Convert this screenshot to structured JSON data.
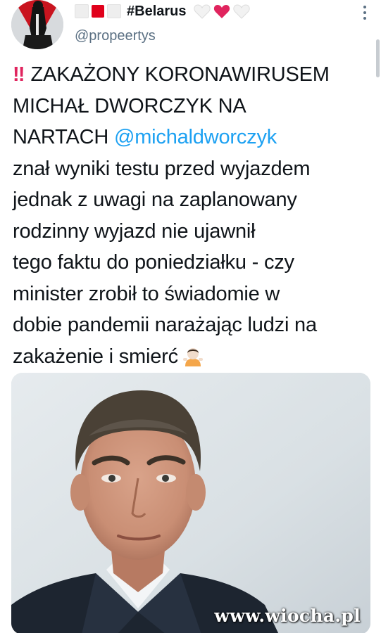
{
  "tweet": {
    "display_name": "#Belarus",
    "handle": "@propeertys",
    "text_lines": [
      {
        "prefix": "‼",
        "text": "ZAKAŻONY KORONAWIRUSEM"
      },
      {
        "text": "MICHAŁ DWORCZYK NA"
      },
      {
        "text": "NARTACH ",
        "mention": "@michaldworczyk"
      },
      {
        "text": "znał wyniki testu przed wyjazdem"
      },
      {
        "text": "jednak z uwagi na zaplanowany"
      },
      {
        "text": "rodzinny wyjazd nie ujawnił"
      },
      {
        "text": "tego faktu do poniedziałku - czy"
      },
      {
        "text": "minister zrobił to świadomie w"
      },
      {
        "text": "dobie pandemii narażając ludzi na"
      },
      {
        "text": "zakażenie i smierć"
      }
    ],
    "name_emojis": [
      "white-square-icon",
      "red-square-icon",
      "white-square-icon",
      "white-heart-icon",
      "red-heart-icon",
      "white-heart-icon"
    ],
    "end_emoji": "person-shrugging-icon"
  },
  "media": {
    "watermark": "www.wiocha.pl"
  },
  "colors": {
    "text": "#0f1419",
    "secondary": "#5b7083",
    "link": "#1da1f2",
    "flag_red": "#e0001b",
    "heart_red": "#e0245e"
  }
}
